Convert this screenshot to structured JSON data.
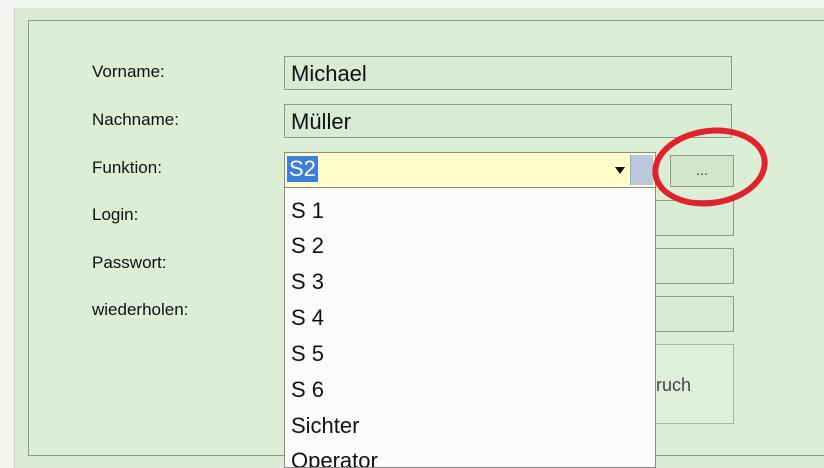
{
  "form": {
    "vorname_label": "Vorname:",
    "vorname_value": "Michael",
    "nachname_label": "Nachname:",
    "nachname_value": "Müller",
    "funktion_label": "Funktion:",
    "funktion_value": "S2",
    "login_label": "Login:",
    "passwort_label": "Passwort:",
    "wiederholen_label": "wiederholen:"
  },
  "buttons": {
    "ellipsis_label": "...",
    "submit_partial_label": "ruch"
  },
  "dropdown_options": [
    "S 1",
    "S 2",
    "S 3",
    "S 4",
    "S 5",
    "S 6",
    "Sichter",
    "Operator"
  ],
  "colors": {
    "panel_background": "#dceed6",
    "selection_highlight": "#3a7fdc",
    "combo_background": "#fffeca",
    "annotation_circle": "#e2222b"
  }
}
